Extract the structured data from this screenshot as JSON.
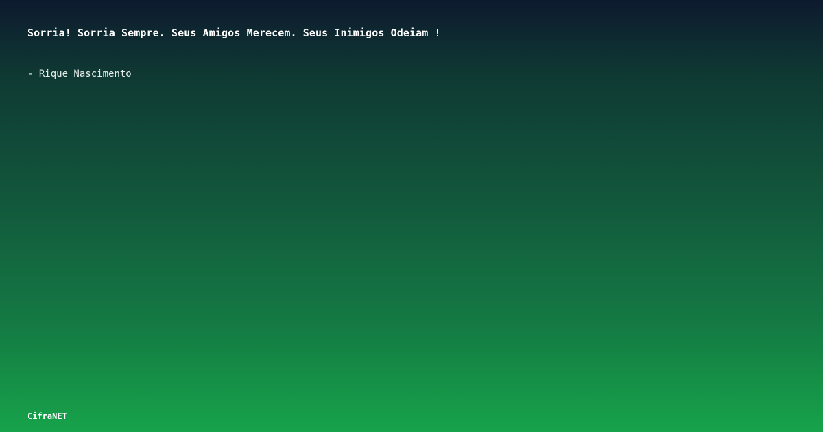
{
  "quote": {
    "text": "Sorria! Sorria Sempre. Seus Amigos Merecem. Seus Inimigos Odeiam !",
    "author": "- Rique Nascimento"
  },
  "brand": {
    "name": "CifraNET"
  },
  "colors": {
    "gradient_top": "#0d1a2e",
    "gradient_bottom": "#16a34a",
    "text": "#ffffff"
  }
}
